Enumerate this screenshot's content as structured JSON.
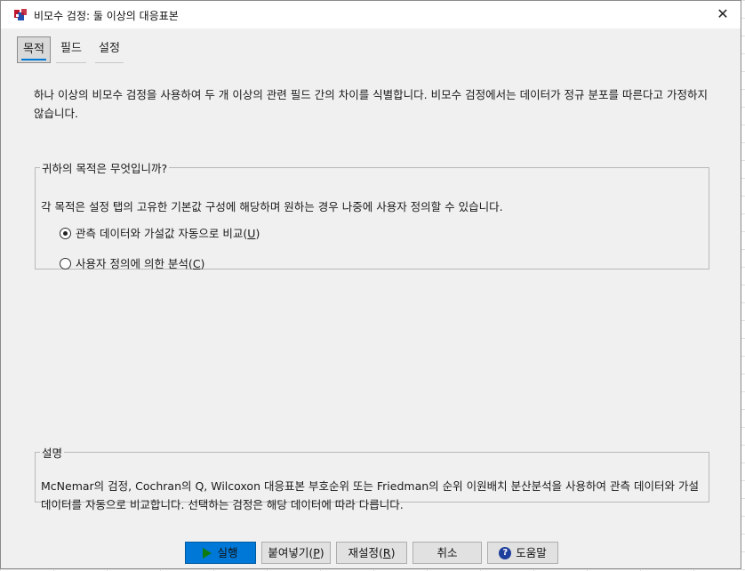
{
  "window": {
    "title": "비모수 검정: 둘 이상의 대응표본",
    "close_symbol": "✕"
  },
  "tabs": [
    {
      "label": "목적",
      "active": true
    },
    {
      "label": "필드",
      "active": false
    },
    {
      "label": "설정",
      "active": false
    }
  ],
  "description": "하나 이상의 비모수 검정을 사용하여 두 개 이상의 관련 필드 간의 차이를 식별합니다. 비모수 검정에서는 데이터가 정규 분포를 따른다고 가정하지 않습니다.",
  "purpose_group": {
    "legend": "귀하의 목적은 무엇입니까?",
    "note": "각 목적은 설정 탭의 고유한 기본값 구성에 해당하며 원하는 경우 나중에 사용자 정의할 수 있습니다.",
    "options": [
      {
        "label": "관측 데이터와 가설값 자동으로 비교(",
        "mnemonic": "U",
        "close": ")",
        "selected": true
      },
      {
        "label": "사용자 정의에 의한 분석(",
        "mnemonic": "C",
        "close": ")",
        "selected": false
      }
    ]
  },
  "desc_group": {
    "legend": "설명",
    "text": "McNemar의 검정, Cochran의 Q, Wilcoxon 대응표본 부호순위 또는 Friedman의 순위 이원배치 분산분석을 사용하여 관측 데이터와 가설 데이터를 자동으로 비교합니다. 선택하는 검정은 해당 데이터에 따라 다릅니다."
  },
  "buttons": {
    "run": "실행",
    "paste": "붙여넣기(",
    "paste_mn": "P",
    "reset": "재설정(",
    "reset_mn": "R",
    "cancel": "취소",
    "help": "도움말",
    "close_paren": ")"
  },
  "colors": {
    "accent": "#0078d7",
    "dialog_bg": "#f0f0f0"
  },
  "icons": {
    "app": "spss-app-icon",
    "run": "play-icon",
    "help": "help-icon"
  }
}
